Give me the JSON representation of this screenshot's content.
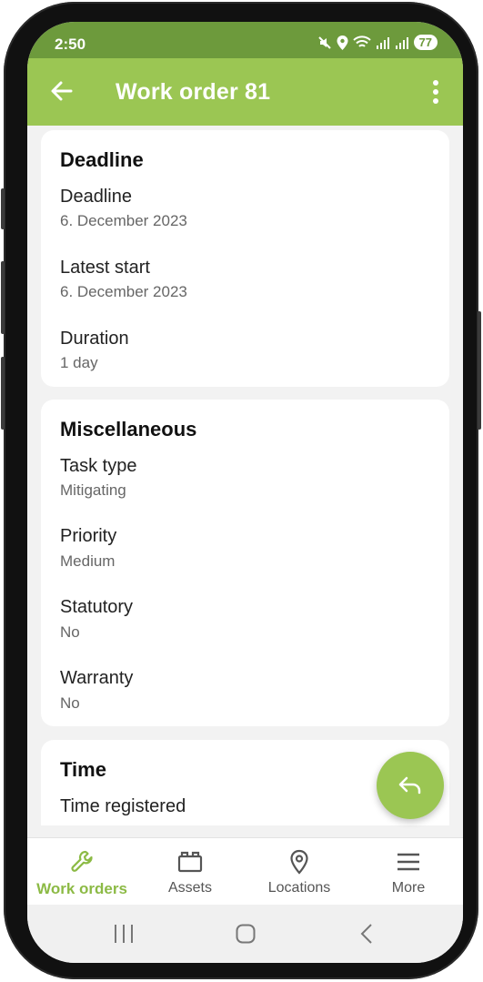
{
  "status_bar": {
    "time": "2:50",
    "battery": "77",
    "icons": [
      "mute-icon",
      "location-icon",
      "wifi-icon",
      "signal-icon",
      "signal-icon"
    ]
  },
  "app_bar": {
    "title": "Work order 81",
    "back_icon": "arrow-left-icon",
    "menu_icon": "more-vert-icon"
  },
  "sections": {
    "deadline": {
      "title": "Deadline",
      "fields": [
        {
          "label": "Deadline",
          "value": "6. December 2023"
        },
        {
          "label": "Latest start",
          "value": "6. December 2023"
        },
        {
          "label": "Duration",
          "value": "1 day"
        }
      ]
    },
    "misc": {
      "title": "Miscellaneous",
      "fields": [
        {
          "label": "Task type",
          "value": "Mitigating"
        },
        {
          "label": "Priority",
          "value": "Medium"
        },
        {
          "label": "Statutory",
          "value": "No"
        },
        {
          "label": "Warranty",
          "value": "No"
        }
      ]
    },
    "time": {
      "title": "Time",
      "fields": [
        {
          "label": "Time registered",
          "value": ""
        }
      ]
    }
  },
  "fab": {
    "icon": "reply-icon"
  },
  "bottom_nav": [
    {
      "label": "Work orders",
      "icon": "wrench-icon",
      "active": true
    },
    {
      "label": "Assets",
      "icon": "box-icon",
      "active": false
    },
    {
      "label": "Locations",
      "icon": "location-pin-icon",
      "active": false
    },
    {
      "label": "More",
      "icon": "hamburger-menu-icon",
      "active": false
    }
  ],
  "colors": {
    "status_bar": "#6d9a3c",
    "app_bar": "#9bc653",
    "accent": "#8cba45",
    "background": "#f2f2f2"
  }
}
